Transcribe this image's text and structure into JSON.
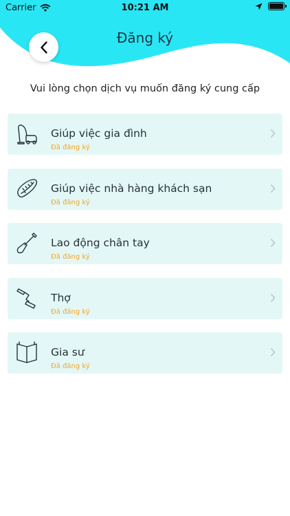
{
  "status_bar": {
    "carrier": "Carrier",
    "time": "10:21 AM"
  },
  "header": {
    "title": "Đăng ký",
    "back_icon": "chevron-left-icon"
  },
  "subtitle": "Vui lòng chọn dịch vụ muốn đăng ký cung cấp",
  "services": [
    {
      "name": "Giúp việc gia đình",
      "status": "Đã đăng ký",
      "icon": "vacuum-cleaner-icon"
    },
    {
      "name": "Giúp việc nhà hàng khách sạn",
      "status": "Đã đăng ký",
      "icon": "hotdog-icon"
    },
    {
      "name": "Lao động chân tay",
      "status": "Đã đăng ký",
      "icon": "shovel-icon"
    },
    {
      "name": "Thợ",
      "status": "Đã đăng ký",
      "icon": "paint-roller-icon"
    },
    {
      "name": "Gia sư",
      "status": "Đã đăng ký",
      "icon": "book-icon"
    }
  ],
  "colors": {
    "header": "#29e6f5",
    "card": "#e3f7f6",
    "status": "#f5a623"
  }
}
